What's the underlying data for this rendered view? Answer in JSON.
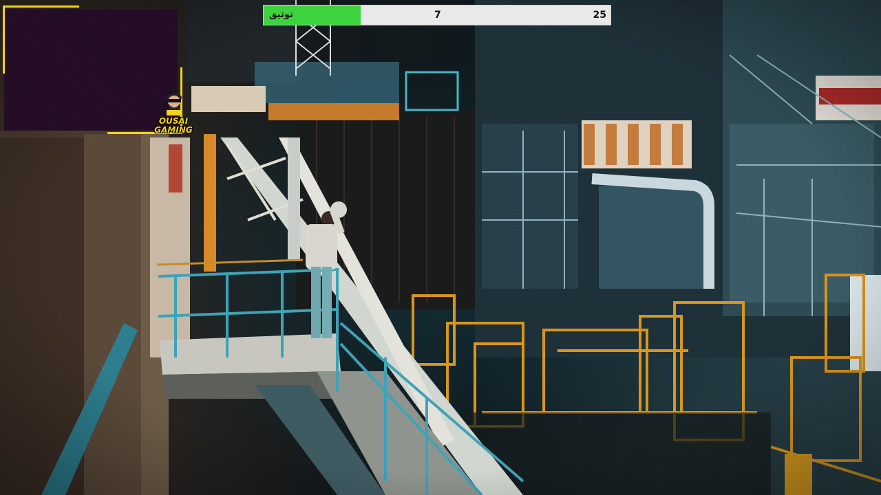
{
  "overlay": {
    "progress": {
      "label": "توثيق",
      "current": "7",
      "total": "25",
      "fill_fraction": 0.28,
      "fill_color": "#3ed23f"
    },
    "logo": {
      "line1": "OUSAI",
      "line2": "GAMING",
      "color": "#f4d21d"
    },
    "webcam_frame_color": "#f2d21c"
  },
  "scene": {
    "icon": "industrial-hangar-photo"
  }
}
